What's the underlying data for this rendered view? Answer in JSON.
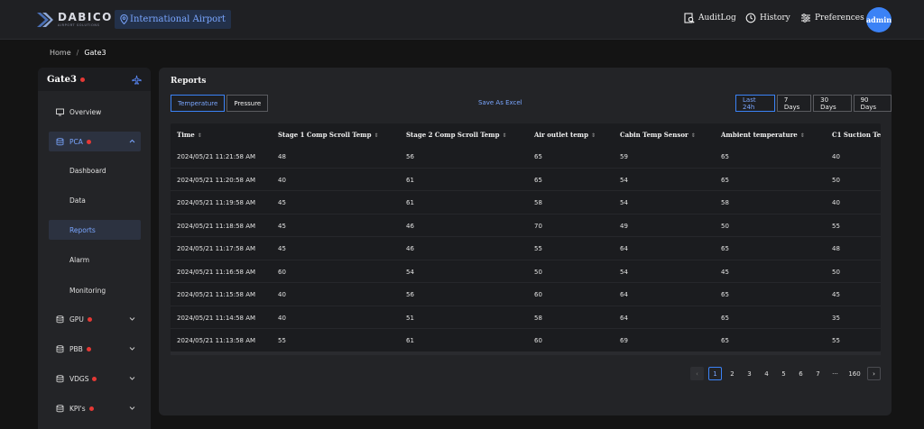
{
  "brand": {
    "name": "DABICO",
    "tagline": "AIRPORT SOLUTIONS"
  },
  "header": {
    "airport": "International Airport",
    "nav": {
      "audit": "AuditLog",
      "history": "History",
      "preferences": "Preferences"
    },
    "avatar": "admin"
  },
  "breadcrumb": {
    "home": "Home",
    "separator": "/",
    "current": "Gate3"
  },
  "sidebar": {
    "title": "Gate3",
    "overview": "Overview",
    "pca": "PCA",
    "pca_sub": [
      "Dashboard",
      "Data",
      "Reports",
      "Alarm",
      "Monitoring"
    ],
    "groups": [
      "GPU",
      "PBB",
      "VDGS",
      "KPI's"
    ]
  },
  "reports": {
    "title": "Reports",
    "tabs": [
      "Temperature",
      "Pressure"
    ],
    "export": "Save As Excel",
    "ranges": [
      "Last 24h",
      "7 Days",
      "30 Days",
      "90 Days"
    ]
  },
  "table": {
    "columns": [
      "Time",
      "Stage 1 Comp Scroll Temp",
      "Stage 2 Comp Scroll Temp",
      "Air outlet temp",
      "Cabin Temp Sensor",
      "Ambient temperature",
      "C1 Suction Ten"
    ],
    "rows": [
      [
        "2024/05/21 11:21:58 AM",
        "48",
        "56",
        "65",
        "59",
        "65",
        "40"
      ],
      [
        "2024/05/21 11:20:58 AM",
        "40",
        "61",
        "65",
        "54",
        "65",
        "50"
      ],
      [
        "2024/05/21 11:19:58 AM",
        "45",
        "61",
        "58",
        "54",
        "58",
        "40"
      ],
      [
        "2024/05/21 11:18:58 AM",
        "45",
        "46",
        "70",
        "49",
        "50",
        "55"
      ],
      [
        "2024/05/21 11:17:58 AM",
        "45",
        "46",
        "55",
        "64",
        "65",
        "48"
      ],
      [
        "2024/05/21 11:16:58 AM",
        "60",
        "54",
        "50",
        "54",
        "45",
        "50"
      ],
      [
        "2024/05/21 11:15:58 AM",
        "40",
        "56",
        "60",
        "64",
        "65",
        "45"
      ],
      [
        "2024/05/21 11:14:58 AM",
        "40",
        "51",
        "58",
        "64",
        "65",
        "35"
      ],
      [
        "2024/05/21 11:13:58 AM",
        "55",
        "61",
        "60",
        "69",
        "65",
        "55"
      ]
    ]
  },
  "pagination": {
    "prev": "‹",
    "next": "›",
    "pages": [
      "1",
      "2",
      "3",
      "4",
      "5",
      "6",
      "7"
    ],
    "ellipsis": "···",
    "last": "160",
    "current": "1"
  },
  "colors": {
    "accent": "#3b82f6",
    "alert": "#e53935",
    "panel": "#232427"
  }
}
